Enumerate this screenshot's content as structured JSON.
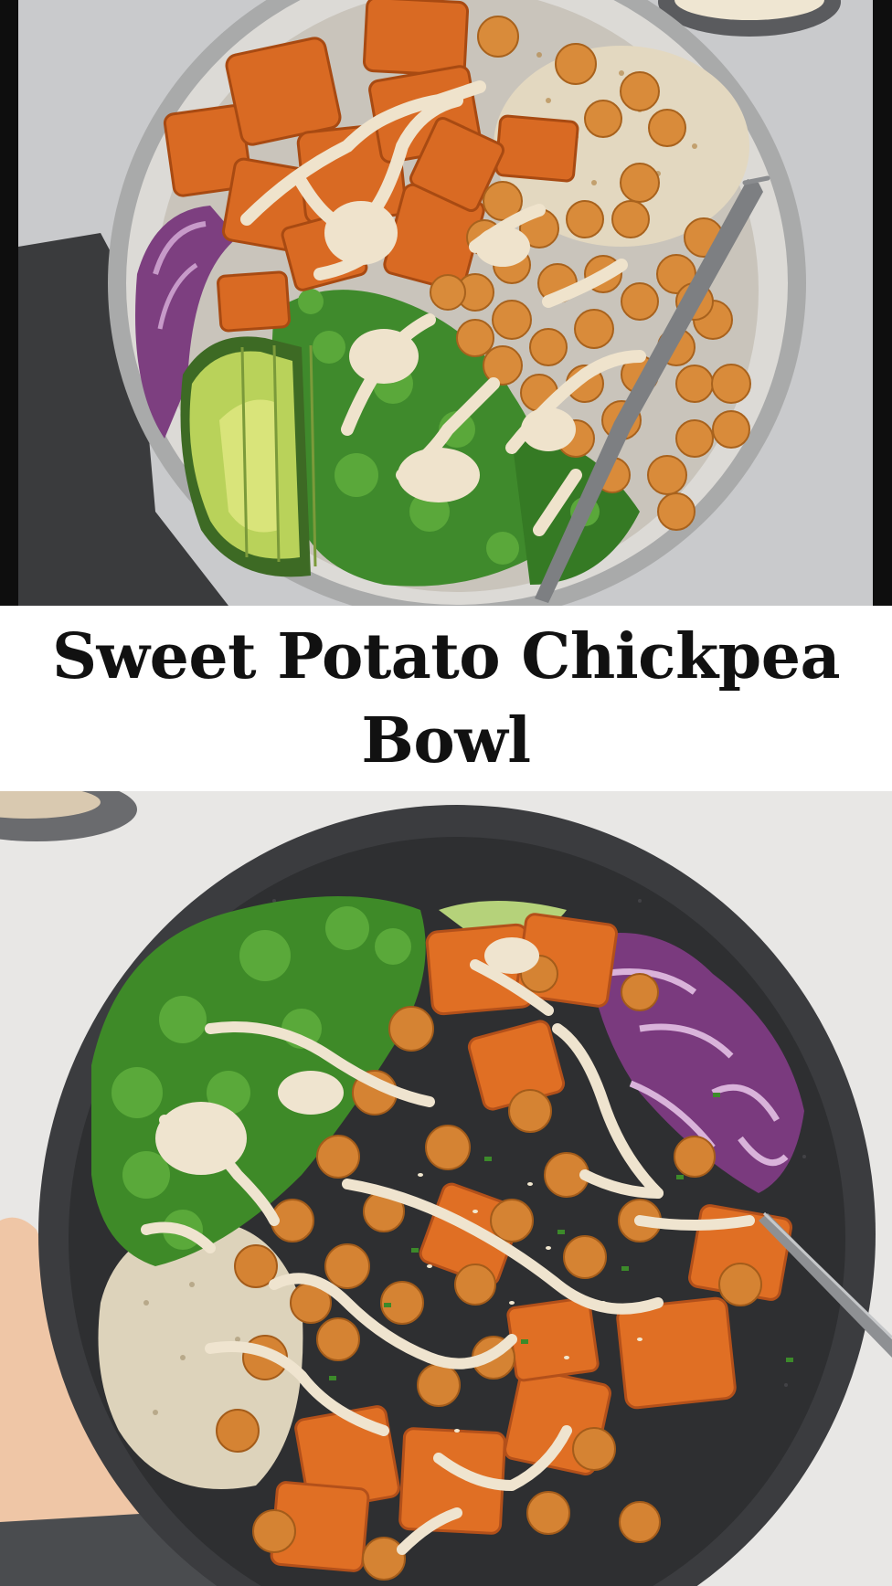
{
  "title": "Sweet Potato Chickpea Bowl",
  "images": [
    {
      "subject": "sweet-potato-chickpea-bowl-top-view-light-bowl"
    },
    {
      "subject": "sweet-potato-chickpea-bowl-top-view-dark-bowl"
    }
  ],
  "colors": {
    "sweet_potato": "#e07a2e",
    "chickpea": "#d98b3a",
    "kale": "#3f8a2c",
    "avocado": "#a9c94f",
    "red_onion": "#8a4a8f",
    "tahini_drizzle": "#efe3cc",
    "quinoa": "#e6dcc4",
    "background_top": "#cfd0d2",
    "background_bottom": "#e9e8e6"
  }
}
